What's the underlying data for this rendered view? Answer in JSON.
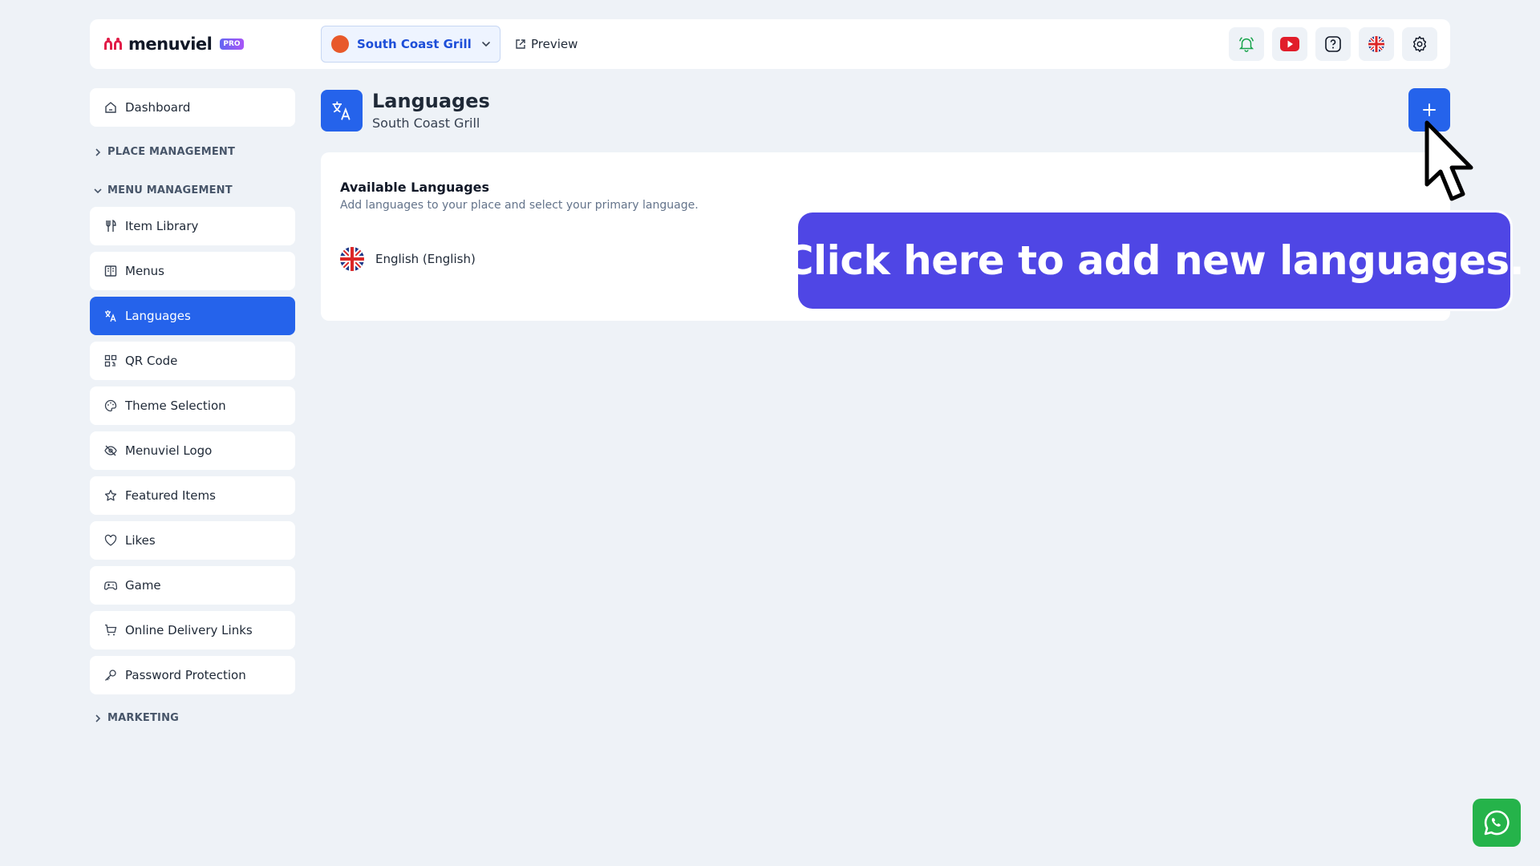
{
  "brand": {
    "name": "menuviel",
    "badge": "PRO",
    "colors": {
      "primary": "#2563eb",
      "callout": "#4f46e5",
      "whatsapp": "#25b34a"
    }
  },
  "topbar": {
    "place_name": "South Coast Grill",
    "preview_label": "Preview",
    "icons": [
      "bell-icon",
      "youtube-icon",
      "help-icon",
      "uk-flag-icon",
      "gear-icon"
    ]
  },
  "sidebar": {
    "dashboard": "Dashboard",
    "place_management": "PLACE MANAGEMENT",
    "menu_management": "MENU MANAGEMENT",
    "items": [
      {
        "label": "Item Library",
        "icon": "utensils-icon"
      },
      {
        "label": "Menus",
        "icon": "book-icon"
      },
      {
        "label": "Languages",
        "icon": "translate-icon",
        "active": true
      },
      {
        "label": "QR Code",
        "icon": "qr-icon"
      },
      {
        "label": "Theme Selection",
        "icon": "palette-icon"
      },
      {
        "label": "Menuviel Logo",
        "icon": "eye-off-icon"
      },
      {
        "label": "Featured Items",
        "icon": "star-icon"
      },
      {
        "label": "Likes",
        "icon": "heart-icon"
      },
      {
        "label": "Game",
        "icon": "gamepad-icon"
      },
      {
        "label": "Online Delivery Links",
        "icon": "cart-icon"
      },
      {
        "label": "Password Protection",
        "icon": "key-icon"
      }
    ],
    "marketing": "MARKETING"
  },
  "main": {
    "title": "Languages",
    "subtitle": "South Coast Grill",
    "card": {
      "title": "Available Languages",
      "description": "Add languages to your place and select your primary language.",
      "languages": [
        {
          "label": "English (English)",
          "flag": "uk-flag"
        }
      ]
    },
    "add_button_icon": "plus-icon"
  },
  "callout": {
    "text": "Click here to add new languages."
  }
}
